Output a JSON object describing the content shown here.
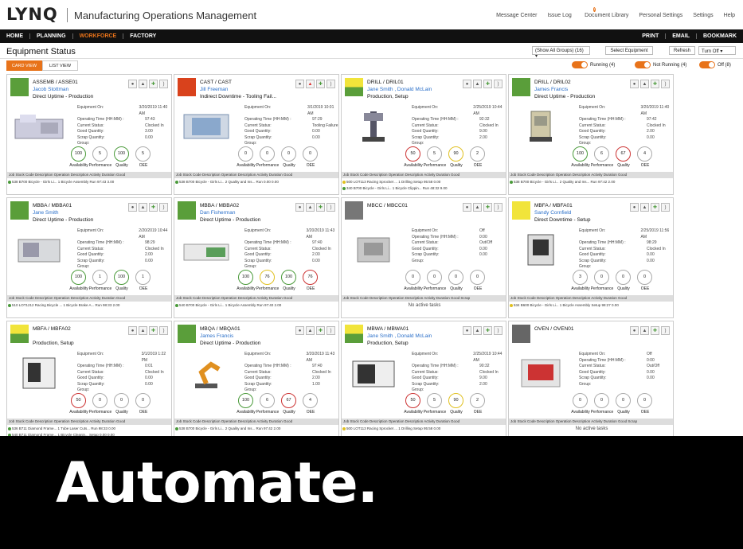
{
  "header": {
    "logo": "LYNQ",
    "title": "Manufacturing Operations Management",
    "links": [
      "Message Center",
      "Issue Log",
      "Document Library",
      "Personal Settings",
      "Settings",
      "Help"
    ],
    "issue_badge": "7"
  },
  "nav": {
    "left": [
      "HOME",
      "PLANNING",
      "WORKFORCE",
      "FACTORY"
    ],
    "right": [
      "PRINT",
      "EMAIL",
      "BOOKMARK"
    ]
  },
  "toolbar": {
    "page_title": "Equipment Status",
    "group_select": "(Show All Groups) (16)",
    "select_equipment": "Select Equipment",
    "refresh": "Refresh",
    "turn_off": "Turn Off"
  },
  "view_tabs": [
    "CARD VIEW",
    "LIST VIEW"
  ],
  "legend": [
    "Running (4)",
    "Not Running (4)",
    "Off (8)"
  ],
  "labels": {
    "equipment_on": "Equipment On:",
    "operating_time": "Operating Time (HH:MM) :",
    "current_status": "Current Status:",
    "good_qty": "Good Quantity:",
    "scrap_qty": "Scrap Quantity:",
    "group": "Group:",
    "availability": "Availability",
    "performance": "Performance",
    "quality": "Quality",
    "oee": "OEE",
    "table_header": "Job  Stock Code  Description     Operation  Description     Activity  Duration  Good",
    "table_header_alt": "Job  Stock Code  Description  Operation  Description  Activity  Duration  Good  Scrap",
    "no_active": "No active tasks"
  },
  "cards": [
    {
      "name": "ASSEMB / ASSE01",
      "operators": "Jacob Stottman",
      "status": "Direct Uptime - Production",
      "on": "3/20/2019 11:40 AM",
      "time": "97:43",
      "cstatus": "Clocked In",
      "good": "3.00",
      "scrap": "0.00",
      "g": [
        "100",
        "5",
        "100",
        "5"
      ],
      "rows": [
        "538  B700        Bicycle - Girls Li...   1        Bicycle Assembly   Run      97:43   3.00"
      ]
    },
    {
      "name": "CAST / CAST",
      "operators": "Jill Freeman",
      "status": "Indirect Downtime - Tooling Fail...",
      "on": "3/1/2019 10:01 AM",
      "time": "97:29",
      "cstatus": "Tooling Failure",
      "good": "0.00",
      "scrap": "0.00",
      "g": [
        "0",
        "0",
        "0",
        "0"
      ],
      "rows": [
        "538  B700        Bicycle - Girls Li...   2        Quality and Ins...   Run      0.00    0.00"
      ]
    },
    {
      "name": "DRILL / DRIL01",
      "operators": "Jane Smith , Donald McLain",
      "status": "Production, Setup",
      "on": "2/25/2019 10:44 AM",
      "time": "92:32",
      "cstatus": "Clocked In",
      "good": "9.00",
      "scrap": "2.00",
      "g": [
        "50",
        "5",
        "90",
        "2"
      ],
      "rows": [
        "500  LOT113      Racing Sprocket ...   1        Drilling      Setup    95:58   0.00",
        "340  B700        Bicycle - Girls Li...   1        Bicycle Clippin...   Run      48:32   9.00"
      ]
    },
    {
      "name": "DRILL / DRIL02",
      "operators": "James Francis",
      "status": "Direct Uptime - Production",
      "on": "3/20/2019 11:40 AM",
      "time": "97:42",
      "cstatus": "Clocked In",
      "good": "2.00",
      "scrap": "0.00",
      "g": [
        "100",
        "6",
        "67",
        "4"
      ],
      "rows": [
        "538  B700        Bicycle - Girls Li...   2        Quality and Ins...   Run      97:42   2.00"
      ]
    },
    {
      "name": "MBBA / MBBA01",
      "operators": "Jane Smith",
      "status": "Direct Uptime - Production",
      "on": "2/20/2019 10:44 AM",
      "time": "98:29",
      "cstatus": "Clocked In",
      "good": "2.00",
      "scrap": "0.00",
      "g": [
        "100",
        "1",
        "100",
        "1"
      ],
      "rows": [
        "510  LOT1212     Racing Bicycle ...   1        Bicycle Brake A...   Run      98:33   2.00"
      ]
    },
    {
      "name": "MBBA / MBBA02",
      "operators": "Dan Fisherman",
      "status": "Direct Uptime - Production",
      "on": "3/20/2019 11:43 AM",
      "time": "97:40",
      "cstatus": "Clocked In",
      "good": "2.00",
      "scrap": "0.00",
      "g": [
        "100",
        "76",
        "100",
        "76"
      ],
      "rows": [
        "540  B700        Bicycle - Girls Li...   1        Bicycle Assembly   Run      97:40   2.00"
      ]
    },
    {
      "name": "MBCC / MBCC01",
      "operators": "",
      "status": "",
      "on": "Off",
      "time": "0:00",
      "cstatus": "Out/Off",
      "good": "0.00",
      "scrap": "0.00",
      "g": [
        "0",
        "0",
        "0",
        "0"
      ],
      "rows": []
    },
    {
      "name": "MBFA / MBFA01",
      "operators": "Sandy Cornfield",
      "status": "Direct Downtime - Setup",
      "on": "2/25/2019 11:56 AM",
      "time": "98:29",
      "cstatus": "Clocked In",
      "good": "0.00",
      "scrap": "0.00",
      "g": [
        "3",
        "0",
        "0",
        "0"
      ],
      "rows": [
        "534  B600        Bicycle - Girls Li...   1        Bicycle Assembly   Setup    98:27   0.00"
      ]
    },
    {
      "name": "MBFA / MBFA02",
      "operators": "",
      "status": "Production, Setup",
      "on": "3/1/2019 1:22 PM",
      "time": "0:01",
      "cstatus": "Clocked In",
      "good": "0.00",
      "scrap": "0.00",
      "g": [
        "50",
        "0",
        "0",
        "0"
      ],
      "rows": [
        "536  B711        Diamond Frame...   1        Tube Laser Cuts...   Run      98:33   0.00",
        "540  B711        Diamond Frame...   1        Bicycle Cleanin...   Setup    0.00    0.00"
      ]
    },
    {
      "name": "MBQA / MBQA01",
      "operators": "James Francis",
      "status": "Direct Uptime - Production",
      "on": "3/20/2019 11:43 AM",
      "time": "97:40",
      "cstatus": "Clocked In",
      "good": "2.00",
      "scrap": "1.00",
      "g": [
        "100",
        "6",
        "67",
        "4"
      ],
      "rows": [
        "538  B700        Bicycle - Girls Li...   2        Quality and Ins...   Run      97:42   2.00"
      ]
    },
    {
      "name": "MBWA / MBWA01",
      "operators": "Jane Smith , Donald McLain",
      "status": "Production, Setup",
      "on": "2/25/2019 10:44 AM",
      "time": "90:32",
      "cstatus": "Clocked In",
      "good": "9.00",
      "scrap": "2.00",
      "g": [
        "50",
        "5",
        "90",
        "2"
      ],
      "rows": [
        "500  LOT113      Racing Sprocket ...   1        Drilling      Setup    95:58   0.00"
      ]
    },
    {
      "name": "OVEN / OVEN01",
      "operators": "",
      "status": "",
      "on": "Off",
      "time": "0:00",
      "cstatus": "Out/Off",
      "good": "0.00",
      "scrap": "0.00",
      "g": [
        "0",
        "0",
        "0",
        "0"
      ],
      "rows": []
    }
  ],
  "tagline": "Automate."
}
